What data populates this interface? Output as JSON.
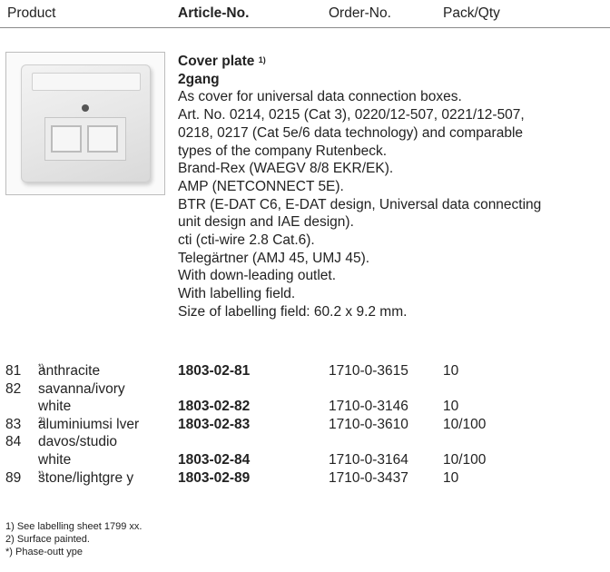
{
  "header": {
    "product": "Product",
    "article_no": "Article-No.",
    "order_no": "Order-No.",
    "pack_qty": "Pack/Qty"
  },
  "product": {
    "title": "Cover plate",
    "title_sup": "1)",
    "subtitle": "2gang",
    "description_lines": [
      "As cover for universal data connection boxes.",
      "Art. No. 0214, 0215 (Cat 3), 0220/12-507, 0221/12-507,",
      "0218, 0217 (Cat 5e/6 data technology) and comparable",
      "types of the company Rutenbeck.",
      "Brand-Rex (WAEGV 8/8 EKR/EK).",
      "AMP (NETCONNECT 5E).",
      "BTR (E-DAT C6, E-DAT design, Universal data connecting",
      "unit design and IAE design).",
      "cti (cti-wire 2.8 Cat.6).",
      "Telegärtner (AMJ 45, UMJ 45).",
      "With down-leading outlet.",
      "With labelling field.",
      "Size of labelling field: 60.2 x 9.2 mm."
    ]
  },
  "variants": [
    {
      "num": "81",
      "name": "anthracite",
      "sup": "*)",
      "article": "1803-02-81",
      "order": "1710-0-3615",
      "pack": "10"
    },
    {
      "num": "82",
      "name": "savanna/ivory",
      "name2": "white",
      "sup": "",
      "article": "1803-02-82",
      "order": "1710-0-3146",
      "pack": "10"
    },
    {
      "num": "83",
      "name": "aluminiumsi lver",
      "sup": "2)",
      "article": "1803-02-83",
      "order": "1710-0-3610",
      "pack": "10/100"
    },
    {
      "num": "84",
      "name": "davos/studio",
      "name2": "white",
      "sup": "",
      "article": "1803-02-84",
      "order": "1710-0-3164",
      "pack": "10/100"
    },
    {
      "num": "89",
      "name": "stone/lightgre y",
      "sup": "*)",
      "article": "1803-02-89",
      "order": "1710-0-3437",
      "pack": "10"
    }
  ],
  "footnotes": [
    "1)  See labelling sheet 1799 xx.",
    "2)  Surface painted.",
    "*)  Phase-outt ype"
  ]
}
